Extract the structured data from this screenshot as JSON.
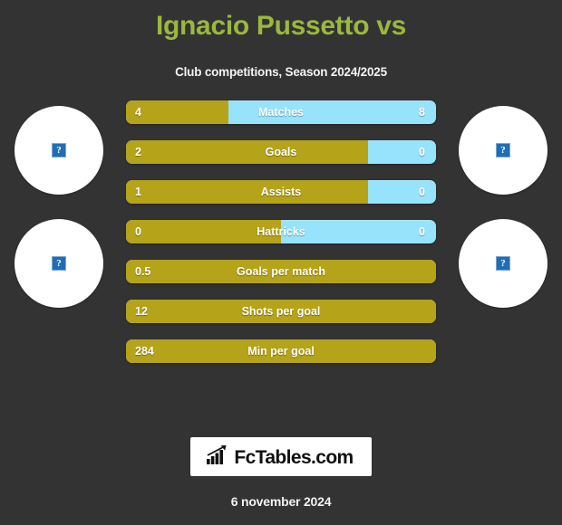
{
  "header": {
    "title": "Ignacio Pussetto vs",
    "subtitle": "Club competitions, Season 2024/2025"
  },
  "colors": {
    "background": "#333333",
    "title_green": "#9ab83e",
    "home_gold": "#b5a31a",
    "away_blue": "#97e3fb",
    "text_white": "#ffffff"
  },
  "badges": {
    "home_1": {
      "icon": "broken-image-icon",
      "glyph": "?"
    },
    "home_2": {
      "icon": "broken-image-icon",
      "glyph": "?"
    },
    "away_1": {
      "icon": "broken-image-icon",
      "glyph": "?"
    },
    "away_2": {
      "icon": "broken-image-icon",
      "glyph": "?"
    }
  },
  "chart_data": {
    "type": "bar",
    "title": "Ignacio Pussetto vs",
    "subtitle": "Club competitions, Season 2024/2025",
    "orientation": "horizontal-diverging",
    "categories": [
      "Matches",
      "Goals",
      "Assists",
      "Hattricks",
      "Goals per match",
      "Shots per goal",
      "Min per goal"
    ],
    "series": [
      {
        "name": "home",
        "color": "#b5a31a",
        "values": [
          "4",
          "2",
          "1",
          "0",
          "0.5",
          "12",
          "284"
        ],
        "fill_percent": [
          33,
          78,
          78,
          50,
          100,
          100,
          100
        ]
      },
      {
        "name": "away",
        "color": "#97e3fb",
        "values": [
          "8",
          "0",
          "0",
          "0",
          null,
          null,
          null
        ],
        "fill_percent": [
          67,
          22,
          22,
          50,
          0,
          0,
          0
        ]
      }
    ]
  },
  "stats": [
    {
      "label": "Matches",
      "left": "4",
      "right": "8",
      "fill": 33,
      "has_right": true
    },
    {
      "label": "Goals",
      "left": "2",
      "right": "0",
      "fill": 78,
      "has_right": true
    },
    {
      "label": "Assists",
      "left": "1",
      "right": "0",
      "fill": 78,
      "has_right": true
    },
    {
      "label": "Hattricks",
      "left": "0",
      "right": "0",
      "fill": 50,
      "has_right": true
    },
    {
      "label": "Goals per match",
      "left": "0.5",
      "right": "",
      "fill": 100,
      "has_right": false
    },
    {
      "label": "Shots per goal",
      "left": "12",
      "right": "",
      "fill": 100,
      "has_right": false
    },
    {
      "label": "Min per goal",
      "left": "284",
      "right": "",
      "fill": 100,
      "has_right": false
    }
  ],
  "footer": {
    "logo_text": "FcTables.com",
    "logo_icon": "bar-chart-growth-icon",
    "date": "6 november 2024"
  }
}
